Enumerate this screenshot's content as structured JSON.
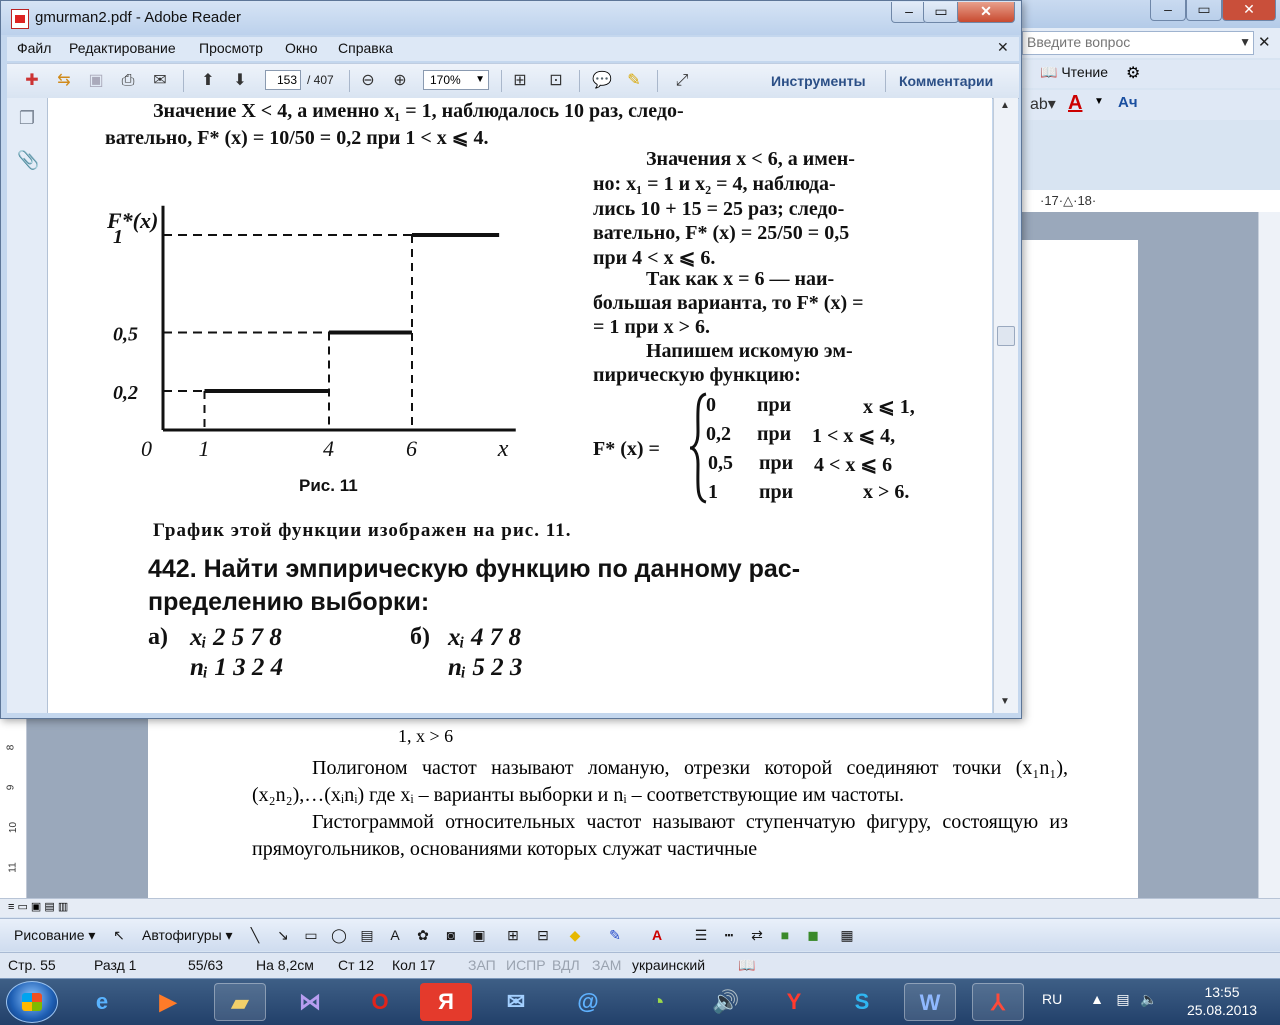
{
  "reader": {
    "title": "gmurman2.pdf - Adobe Reader",
    "menu": [
      "Файл",
      "Редактирование",
      "Просмотр",
      "Окно",
      "Справка"
    ],
    "page_current": "153",
    "page_total": "/ 407",
    "zoom": "170%",
    "tools_label": "Инструменты",
    "comments_label": "Комментарии",
    "page": {
      "line1": "Значение X < 4, а именно x₁ = 1, наблюдалось 10 раз, следо-",
      "line2": "вательно, F* (x) = 10/50 = 0,2 при 1 < x ⩽ 4.",
      "right_text": [
        "Значения x < 6, а имен-",
        "но: x₁ = 1 и x₂ = 4, наблюда-",
        "лись 10 + 15 = 25 раз; следо-",
        "вательно, F* (x) = 25/50 = 0,5",
        "при 4 < x ⩽ 6.",
        "Так как x = 6 — наи-",
        "большая варианта, то F* (x) =",
        "= 1 при x > 6.",
        "Напишем искомую эм-",
        "пирическую функцию:"
      ],
      "function_lhs": "F* (x) =",
      "function_cases": [
        {
          "value": "0",
          "word": "при",
          "cond": "x ⩽ 1,"
        },
        {
          "value": "0,2",
          "word": "при",
          "cond": "1 < x ⩽ 4,"
        },
        {
          "value": "0,5",
          "word": "при",
          "cond": "4 < x ⩽ 6"
        },
        {
          "value": "1",
          "word": "при",
          "cond": "x > 6."
        }
      ],
      "figure_caption": "Рис. 11",
      "after_figure": "График этой функции изображен на рис. 11.",
      "problem": "442. Найти эмпирическую функцию по данному рас-",
      "problem2": "пределению выборки:",
      "table_a_label": "а)",
      "table_a_x": "xᵢ  2  5  7  8",
      "table_a_n": "nᵢ  1  3  2  4",
      "table_b_label": "б)",
      "table_b_x": "xᵢ  4  7  8",
      "table_b_n": "nᵢ  5  2  3"
    }
  },
  "chart_data": {
    "type": "line",
    "title": "",
    "ylabel": "F*(x)",
    "xlabel": "x",
    "x_ticks": [
      "0",
      "1",
      "4",
      "6"
    ],
    "y_ticks": [
      "0,2",
      "0,5",
      "1"
    ],
    "xlim": [
      0,
      8.5
    ],
    "ylim": [
      0,
      1.15
    ],
    "steps": [
      {
        "x_start": 1,
        "x_end": 4,
        "y": 0.2
      },
      {
        "x_start": 4,
        "x_end": 6,
        "y": 0.5
      },
      {
        "x_start": 6,
        "x_end": 8.1,
        "y": 1
      }
    ]
  },
  "word": {
    "help_placeholder": "Введите вопрос",
    "reading_label": "Чтение",
    "ruler_marks": "·17·△·18·",
    "eq_line": "1,         x > 6",
    "paragraph1": "Полигоном частот называют ломаную, отрезки которой соединяют точки (x₁n₁), (x₂n₂),…(xᵢnᵢ) где xᵢ – варианты выборки и nᵢ – соответствующие им частоты.",
    "paragraph2": "Гистограммой относительных частот называют ступенчатую фигуру, состоящую из прямоугольников, основаниями которых служат частичные",
    "drawing_label": "Рисование ▾",
    "autoshapes_label": "Автофигуры ▾",
    "status": {
      "page": "Стр. 55",
      "section": "Разд 1",
      "pages": "55/63",
      "at": "На 8,2см",
      "line": "Ст 12",
      "col": "Кол 17",
      "rec": "ЗАП",
      "trk": "ИСПР",
      "ext": "ВДЛ",
      "ovr": "ЗАМ",
      "lang": "украинский"
    }
  },
  "taskbar": {
    "lang": "RU",
    "time": "13:55",
    "date": "25.08.2013"
  }
}
